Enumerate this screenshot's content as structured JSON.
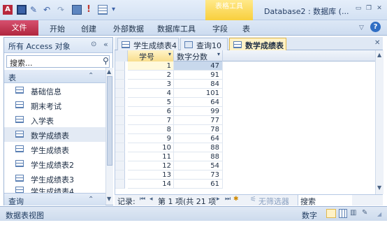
{
  "window": {
    "title": "Database2 : 数据库 (...",
    "context_tab": "表格工具"
  },
  "ribbon": {
    "file": "文件",
    "tabs": [
      "开始",
      "创建",
      "外部数据",
      "数据库工具",
      "字段",
      "表"
    ]
  },
  "nav_pane": {
    "title": "所有 Access 对象",
    "search_placeholder": "搜索...",
    "group": "表",
    "items": [
      "基础信息",
      "期末考试",
      "入学表",
      "数学成绩表",
      "学生成绩表",
      "学生成绩表2",
      "学生成绩表3",
      "学生成绩表4"
    ],
    "selected": "数学成绩表",
    "footer_group": "查询"
  },
  "doc_tabs": [
    "学生成绩表4",
    "查询10",
    "数学成绩表"
  ],
  "active_tab": "数学成绩表",
  "datasheet": {
    "columns": [
      "学号",
      "数字分数"
    ],
    "rows": [
      [
        "1",
        "47"
      ],
      [
        "2",
        "91"
      ],
      [
        "3",
        "84"
      ],
      [
        "4",
        "101"
      ],
      [
        "5",
        "64"
      ],
      [
        "6",
        "99"
      ],
      [
        "7",
        "77"
      ],
      [
        "8",
        "78"
      ],
      [
        "9",
        "64"
      ],
      [
        "10",
        "88"
      ],
      [
        "11",
        "88"
      ],
      [
        "12",
        "54"
      ],
      [
        "13",
        "73"
      ],
      [
        "14",
        "61"
      ]
    ]
  },
  "record_nav": {
    "label": "记录:",
    "position": "第 1 项(共 21 项",
    "filter": "无筛选器",
    "search": "搜索"
  },
  "status": {
    "left": "数据表视图",
    "right": "数字"
  }
}
